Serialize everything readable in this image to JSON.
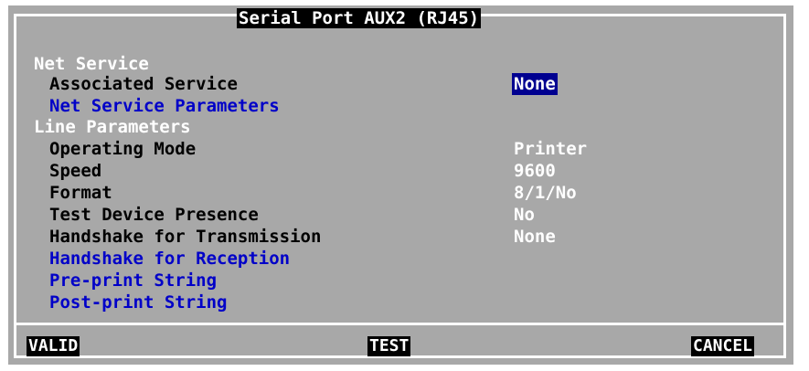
{
  "window": {
    "title": "Serial Port AUX2 (RJ45)"
  },
  "net_service": {
    "section_label": "Net Service",
    "associated_service": {
      "label": "Associated Service",
      "value": "None"
    },
    "parameters_link": "Net Service Parameters"
  },
  "line_parameters": {
    "section_label": "Line Parameters",
    "operating_mode": {
      "label": "Operating Mode",
      "value": "Printer"
    },
    "speed": {
      "label": "Speed",
      "value": "9600"
    },
    "format": {
      "label": "Format",
      "value": "8/1/No"
    },
    "test_device_presence": {
      "label": "Test Device Presence",
      "value": "No"
    },
    "handshake_transmission": {
      "label": "Handshake for Transmission",
      "value": "None"
    },
    "handshake_reception_link": "Handshake for Reception",
    "preprint_link": "Pre-print String",
    "postprint_link": "Post-print String"
  },
  "buttons": {
    "valid": "VALID",
    "test": "TEST",
    "cancel": "CANCEL"
  },
  "colors": {
    "background": "#a8a8a8",
    "link": "#0000c8",
    "selected_highlight": "#000090"
  }
}
